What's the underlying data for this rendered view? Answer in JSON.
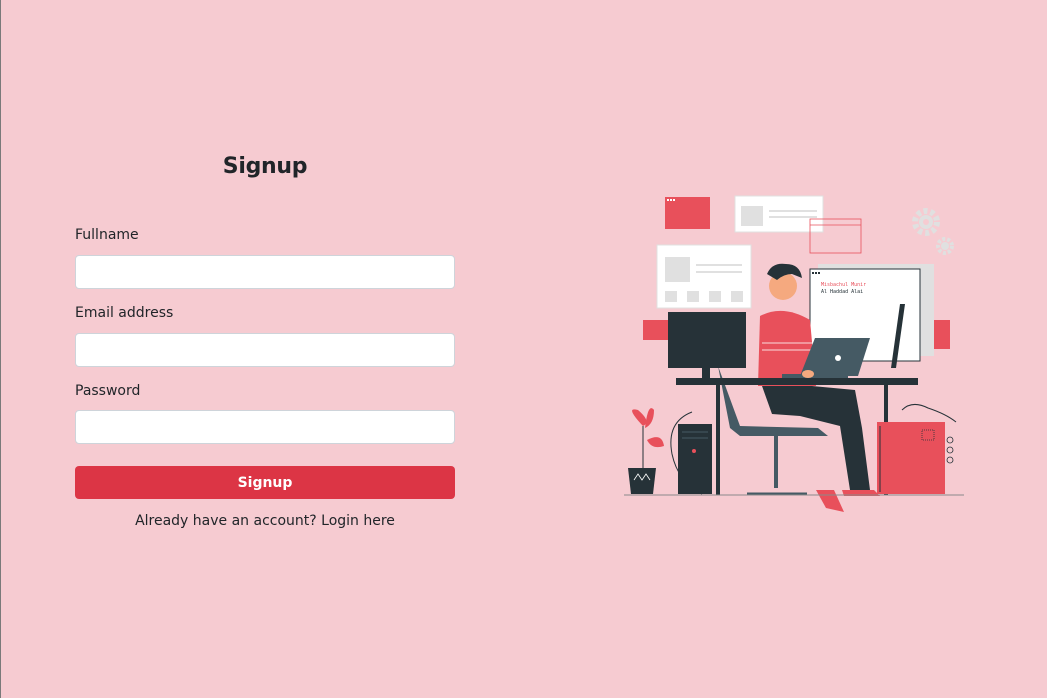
{
  "signup": {
    "title": "Signup",
    "fields": {
      "fullname": {
        "label": "Fullname",
        "value": "",
        "placeholder": ""
      },
      "email": {
        "label": "Email address",
        "value": "",
        "placeholder": ""
      },
      "password": {
        "label": "Password",
        "value": "",
        "placeholder": ""
      }
    },
    "submit_label": "Signup",
    "login_prompt": "Already have an account?",
    "login_link": "Login here"
  },
  "illustration": {
    "monitor_line1": "Misbachul Munir",
    "monitor_line2": "Al Haddad Alai"
  },
  "colors": {
    "background": "#f6cbd1",
    "accent": "#dc3545",
    "illustration_red": "#e8505b",
    "illustration_dark": "#263238"
  }
}
